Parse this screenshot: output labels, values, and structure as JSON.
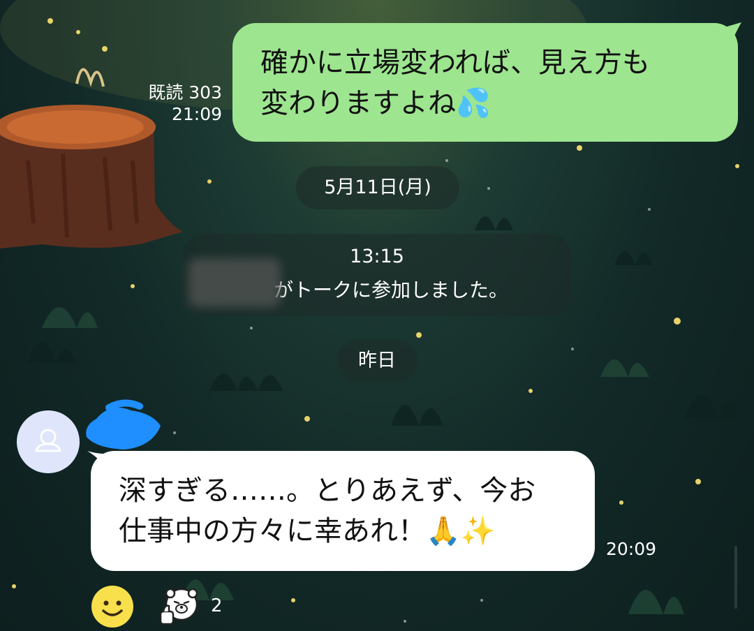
{
  "outgoing_message": {
    "lines": [
      "確かに立場変われば、見え方も",
      "変わりますよね💦"
    ],
    "read_label": "既読 303",
    "time": "21:09"
  },
  "date_separator": "5月11日(月)",
  "system_message": {
    "time": "13:15",
    "text": "がトーク に参加しました。",
    "text_display": "がトークに参加しました。"
  },
  "day_separator": "昨日",
  "incoming_message": {
    "lines": [
      "深すぎる……。とりあえず、今お",
      "仕事中の方々に幸あれ！🙏✨"
    ],
    "time": "20:09"
  },
  "reactions": {
    "add_reaction_icon": "smiley-face-icon",
    "reaction_icon": "bear-thumbs-up-icon",
    "count": "2"
  },
  "colors": {
    "outgoing_bubble": "#9de58f",
    "incoming_bubble": "#ffffff",
    "avatar_bg": "#dfe6fb",
    "smiley": "#f7e04b"
  }
}
